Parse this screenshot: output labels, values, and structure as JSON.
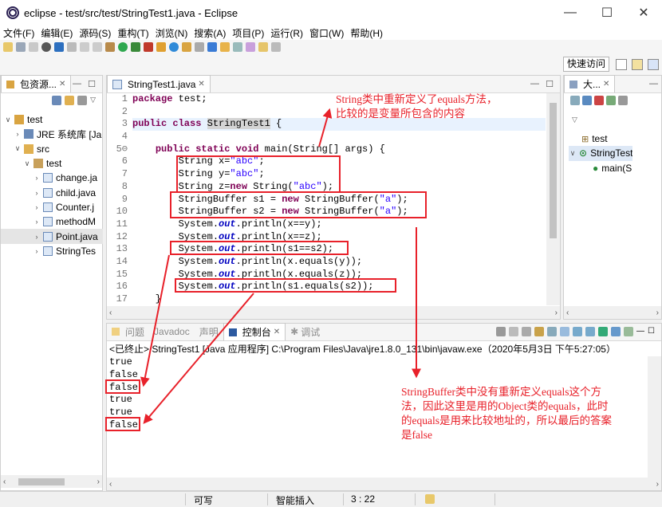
{
  "window": {
    "title": "eclipse - test/src/test/StringTest1.java - Eclipse",
    "minimize": "—",
    "maximize": "☐",
    "close": "✕"
  },
  "menu": [
    "文件(F)",
    "编辑(E)",
    "源码(S)",
    "重构(T)",
    "浏览(N)",
    "搜索(A)",
    "项目(P)",
    "运行(R)",
    "窗口(W)",
    "帮助(H)"
  ],
  "quick_access": "快速访问",
  "package_explorer": {
    "tab": "包资源...",
    "tree": [
      {
        "label": "test",
        "twisty": "∨",
        "icon": "project-icon",
        "indent": 0
      },
      {
        "label": "JRE 系统库 [Ja",
        "twisty": "›",
        "icon": "library-icon",
        "indent": 1
      },
      {
        "label": "src",
        "twisty": "∨",
        "icon": "source-folder-icon",
        "indent": 1
      },
      {
        "label": "test",
        "twisty": "∨",
        "icon": "package-icon",
        "indent": 2
      },
      {
        "label": "change.ja",
        "twisty": "›",
        "icon": "java-file-icon",
        "indent": 3
      },
      {
        "label": "child.java",
        "twisty": "›",
        "icon": "java-file-icon",
        "indent": 3
      },
      {
        "label": "Counter.j",
        "twisty": "›",
        "icon": "java-file-icon",
        "indent": 3
      },
      {
        "label": "methodM",
        "twisty": "›",
        "icon": "java-file-icon",
        "indent": 3
      },
      {
        "label": "Point.java",
        "twisty": "›",
        "icon": "java-file-icon",
        "indent": 3
      },
      {
        "label": "StringTes",
        "twisty": "›",
        "icon": "java-file-icon",
        "indent": 3
      }
    ]
  },
  "editor": {
    "tab": "StringTest1.java",
    "line_numbers": [
      "1",
      "2",
      "3",
      "4",
      "5⊖",
      "6",
      "7",
      "8",
      "9",
      "10",
      "11",
      "12",
      "13",
      "14",
      "15",
      "16",
      "17"
    ]
  },
  "outline": {
    "tab": "大...",
    "items": [
      "test",
      "StringTest",
      "main(S"
    ]
  },
  "bottom_tabs": [
    "问题",
    "Javadoc",
    "声明",
    "控制台",
    "调试"
  ],
  "console": {
    "header": "<已终止> StringTest1 [Java 应用程序] C:\\Program Files\\Java\\jre1.8.0_131\\bin\\javaw.exe（2020年5月3日 下午5:27:05）",
    "output": [
      "true",
      "false",
      "false",
      "true",
      "true",
      "false"
    ]
  },
  "status": {
    "writable": "可写",
    "insert_mode": "智能插入",
    "position": "3 : 22"
  },
  "annotations": {
    "top_note": "String类中重新定义了equals方法，\n比较的是变量所包含的内容",
    "bottom_note": "StringBuffer类中没有重新定义equals这个方\n法，因此这里是用的Object类的equals，此时\n的equals是用来比较地址的，所以最后的答案\n是false"
  },
  "colors": {
    "annotation_red": "#e8212a",
    "keyword": "#7f0055",
    "string_literal": "#2a00ff",
    "static_field": "#0000c0"
  }
}
